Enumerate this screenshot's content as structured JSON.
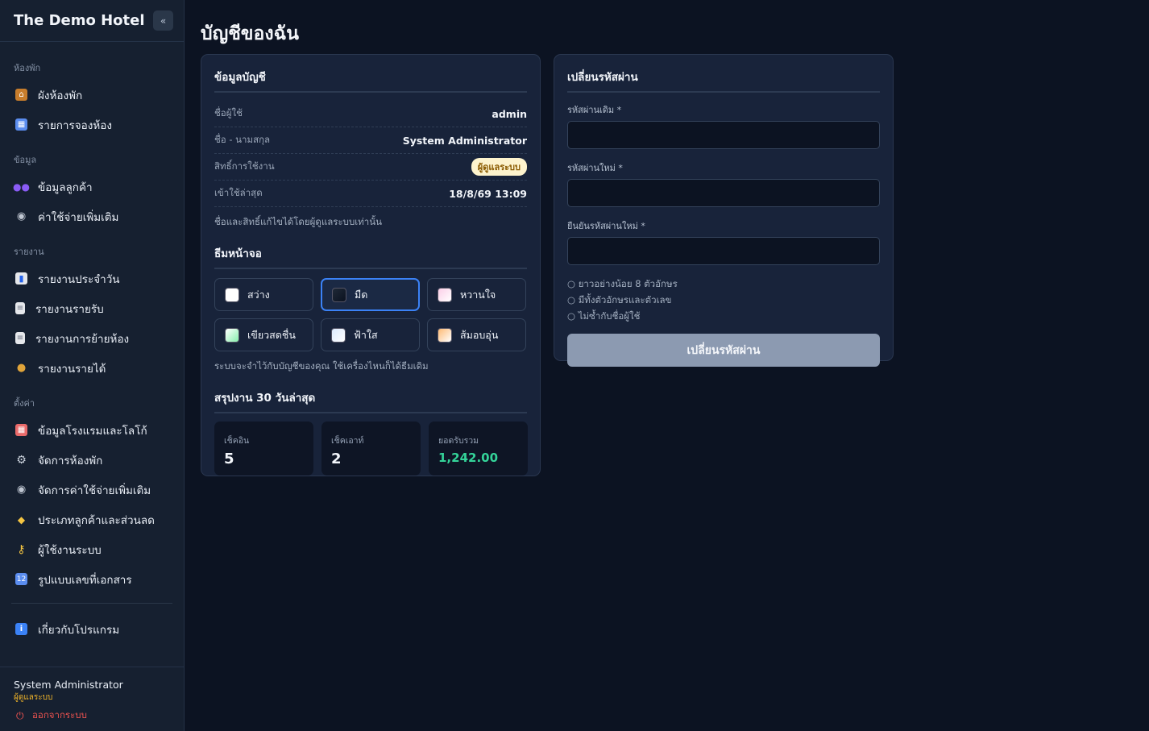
{
  "sidebar": {
    "brand": "The Demo Hotel",
    "collapse_icon": "«",
    "sections": [
      {
        "label": "ห้องพัก",
        "items": [
          {
            "label": "ผังห้องพัก",
            "icon": "house-icon",
            "glyph": "🏠",
            "color": "#e6a23c"
          },
          {
            "label": "รายการจองห้อง",
            "icon": "calendar-icon",
            "glyph": "▦",
            "color": "#5b8def"
          }
        ]
      },
      {
        "label": "ข้อมูล",
        "items": [
          {
            "label": "ข้อมูลลูกค้า",
            "icon": "users-icon",
            "glyph": "👥",
            "color": "#8b5cf6"
          },
          {
            "label": "ค่าใช้จ่ายเพิ่มเติม",
            "icon": "dining-icon",
            "glyph": "🍽",
            "color": "#c0c7d2"
          }
        ]
      },
      {
        "label": "รายงาน",
        "items": [
          {
            "label": "รายงานประจำวัน",
            "icon": "bar-chart-icon",
            "glyph": "▮",
            "color": "#60a5fa"
          },
          {
            "label": "รายงานรายรับ",
            "icon": "document-icon",
            "glyph": "▤",
            "color": "#cbd2dc"
          },
          {
            "label": "รายงานการย้ายห้อง",
            "icon": "document-icon",
            "glyph": "▤",
            "color": "#cbd2dc"
          },
          {
            "label": "รายงานรายได้",
            "icon": "money-bag-icon",
            "glyph": "●",
            "color": "#e0a43a"
          }
        ]
      },
      {
        "label": "ตั้งค่า",
        "items": [
          {
            "label": "ข้อมูลโรงแรมและโลโก้",
            "icon": "hotel-icon",
            "glyph": "▦",
            "color": "#e96a6a"
          },
          {
            "label": "จัดการห้องพัก",
            "icon": "gear-icon",
            "glyph": "⚙",
            "color": "#cbd2dc"
          },
          {
            "label": "จัดการค่าใช้จ่ายเพิ่มเติม",
            "icon": "dining-icon",
            "glyph": "🍽",
            "color": "#c0c7d2"
          },
          {
            "label": "ประเภทลูกค้าและส่วนลด",
            "icon": "tag-icon",
            "glyph": "◆",
            "color": "#f5c542"
          },
          {
            "label": "ผู้ใช้งานระบบ",
            "icon": "key-icon",
            "glyph": "⚷",
            "color": "#f5c542"
          },
          {
            "label": "รูปแบบเลขที่เอกสาร",
            "icon": "numbers-icon",
            "glyph": "#",
            "color": "#5b8def"
          }
        ]
      }
    ],
    "about": {
      "label": "เกี่ยวกับโปรแกรม",
      "icon": "info-icon",
      "glyph": "i",
      "color": "#3b82f6"
    },
    "footer": {
      "name": "System Administrator",
      "role": "ผู้ดูแลระบบ",
      "logout": "ออกจากระบบ"
    }
  },
  "page": {
    "title": "บัญชีของฉัน"
  },
  "account": {
    "title": "ข้อมูลบัญชี",
    "rows": [
      {
        "label": "ชื่อผู้ใช้",
        "value": "admin"
      },
      {
        "label": "ชื่อ - นามสกุล",
        "value": "System Administrator"
      },
      {
        "label": "สิทธิ์การใช้งาน",
        "value": "ผู้ดูแลระบบ"
      },
      {
        "label": "เข้าใช้ล่าสุด",
        "value": "18/8/69 13:09"
      }
    ],
    "note": "ชื่อและสิทธิ์แก้ไขได้โดยผู้ดูแลระบบเท่านั้น"
  },
  "theme": {
    "title": "ธีมหน้าจอ",
    "options": [
      {
        "label": "สว่าง",
        "swatch": "#ffffff",
        "active": false
      },
      {
        "label": "มืด",
        "swatch": "#111827",
        "active": true
      },
      {
        "label": "หวานใจ",
        "swatch": "#f9c6d8",
        "active": false
      },
      {
        "label": "เขียวสดชื่น",
        "swatch": "#bbf0d0",
        "active": false
      },
      {
        "label": "ฟ้าใส",
        "swatch": "#dbeafe",
        "active": false
      },
      {
        "label": "ส้มอบอุ่น",
        "swatch": "#fcd9bd",
        "active": false
      }
    ],
    "note": "ระบบจะจำไว้กับบัญชีของคุณ ใช้เครื่องไหนก็ได้ธีมเดิม"
  },
  "summary": {
    "title": "สรุปงาน 30 วันล่าสุด",
    "stats": [
      {
        "label": "เช็คอิน",
        "value": "5"
      },
      {
        "label": "เช็คเอาท์",
        "value": "2"
      },
      {
        "label": "ยอดรับรวม",
        "value": "1,242.00"
      }
    ]
  },
  "password": {
    "title": "เปลี่ยนรหัสผ่าน",
    "fields": [
      {
        "label": "รหัสผ่านเดิม *",
        "value": ""
      },
      {
        "label": "รหัสผ่านใหม่ *",
        "value": ""
      },
      {
        "label": "ยืนยันรหัสผ่านใหม่ *",
        "value": ""
      }
    ],
    "rules": [
      "○ ยาวอย่างน้อย 8 ตัวอักษร",
      "○ มีทั้งตัวอักษรและตัวเลข",
      "○ ไม่ซ้ำกับชื่อผู้ใช้"
    ],
    "submit": "เปลี่ยนรหัสผ่าน"
  }
}
